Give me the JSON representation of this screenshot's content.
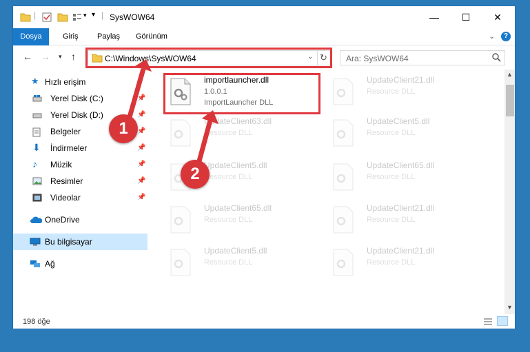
{
  "window": {
    "title": "SysWOW64",
    "controls": {
      "minimize": "—",
      "maximize": "☐",
      "close": "✕"
    }
  },
  "ribbon": {
    "tabs": [
      "Dosya",
      "Giriş",
      "Paylaş",
      "Görünüm"
    ],
    "collapse": "⌄",
    "help": "?"
  },
  "address": {
    "path": "C:\\Windows\\SysWOW64",
    "search_placeholder": "Ara: SysWOW64"
  },
  "sidebar": {
    "quick_access": "Hızlı erişim",
    "items": [
      {
        "label": "Yerel Disk (C:)",
        "icon": "drive-icon",
        "pinned": true
      },
      {
        "label": "Yerel Disk (D:)",
        "icon": "drive-icon",
        "pinned": true
      },
      {
        "label": "Belgeler",
        "icon": "documents-icon",
        "pinned": true
      },
      {
        "label": "İndirmeler",
        "icon": "download-icon",
        "pinned": true
      },
      {
        "label": "Müzik",
        "icon": "music-icon",
        "pinned": true
      },
      {
        "label": "Resimler",
        "icon": "pictures-icon",
        "pinned": true
      },
      {
        "label": "Videolar",
        "icon": "videos-icon",
        "pinned": true
      }
    ],
    "onedrive": "OneDrive",
    "this_pc": "Bu bilgisayar",
    "network": "Ağ"
  },
  "files": [
    {
      "name": "importlauncher.dll",
      "version": "1.0.0.1",
      "desc": "ImportLauncher DLL",
      "highlight": true
    },
    {
      "name": "UpdateClient21.dll",
      "desc": "Resource DLL"
    },
    {
      "name": "UpdateClient63.dll",
      "desc": "Resource DLL"
    },
    {
      "name": "UpdateClient5.dll",
      "desc": "Resource DLL"
    },
    {
      "name": "UpdateClient5.dll",
      "desc": "Resource DLL"
    },
    {
      "name": "UpdateClient65.dll",
      "desc": "Resource DLL"
    },
    {
      "name": "UpdateClient65.dll",
      "desc": "Resource DLL"
    },
    {
      "name": "UpdateClient21.dll",
      "desc": "Resource DLL"
    },
    {
      "name": "UpdateClient5.dll",
      "desc": "Resource DLL"
    },
    {
      "name": "UpdateClient21.dll",
      "desc": "Resource DLL"
    }
  ],
  "status": {
    "count": "198 öğe"
  },
  "annotations": {
    "step1": "1",
    "step2": "2",
    "color": "#d9363a"
  }
}
